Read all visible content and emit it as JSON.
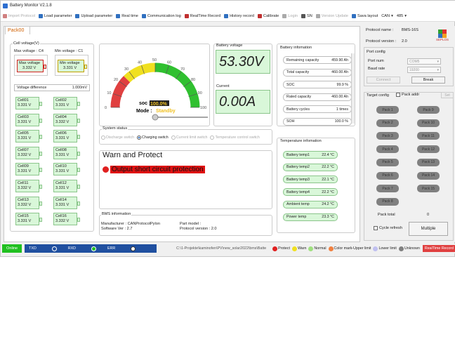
{
  "window": {
    "title": "Battery Monitor V2.1.8"
  },
  "toolbar": {
    "items": [
      {
        "label": "Import Protocol",
        "enabled": false,
        "color": "#d08080"
      },
      {
        "label": "Load parameter",
        "enabled": true,
        "color": "#3070c0"
      },
      {
        "label": "Upload parameter",
        "enabled": true,
        "color": "#3070c0"
      },
      {
        "label": "Real time",
        "enabled": true,
        "color": "#3070c0"
      },
      {
        "label": "Communication log",
        "enabled": true,
        "color": "#3070c0"
      },
      {
        "label": "RealTime Record",
        "enabled": true,
        "color": "#c03030"
      },
      {
        "label": "History record",
        "enabled": true,
        "color": "#3070c0"
      },
      {
        "label": "Calibrate",
        "enabled": true,
        "color": "#c03030"
      },
      {
        "label": "Login",
        "enabled": false,
        "color": "#aaaaaa"
      },
      {
        "label": "SN",
        "enabled": true,
        "color": "#555555"
      },
      {
        "label": "Version Update",
        "enabled": false,
        "color": "#aaaaaa"
      },
      {
        "label": "Sava layout",
        "enabled": true,
        "color": "#3070c0"
      }
    ],
    "protocol_select": "CAN",
    "model_select": "485"
  },
  "tab": "Pack00",
  "cell_voltage": {
    "title": "Cell voltage(V)",
    "max_label": "Max voltage : C4",
    "min_label": "Min voltage : C1",
    "max_box_label": "Max voltage",
    "max_box_value": "3.332 V",
    "min_box_label": "Min voltage",
    "min_box_value": "3.331 V",
    "diff_label": "Voltage difference",
    "diff_value": "1.000mV",
    "cells": [
      {
        "name": "Cell01",
        "v": "3.331 V"
      },
      {
        "name": "Cell02",
        "v": "3.331 V"
      },
      {
        "name": "Cell03",
        "v": "3.331 V"
      },
      {
        "name": "Cell04",
        "v": "3.332 V"
      },
      {
        "name": "Cell05",
        "v": "3.331 V"
      },
      {
        "name": "Cell06",
        "v": "3.331 V"
      },
      {
        "name": "Cell07",
        "v": "3.332 V"
      },
      {
        "name": "Cell08",
        "v": "3.331 V"
      },
      {
        "name": "Cell09",
        "v": "3.331 V"
      },
      {
        "name": "Cell10",
        "v": "3.331 V"
      },
      {
        "name": "Cell11",
        "v": "3.332 V"
      },
      {
        "name": "Cell12",
        "v": "3.331 V"
      },
      {
        "name": "Cell13",
        "v": "3.332 V"
      },
      {
        "name": "Cell14",
        "v": "3.331 V"
      },
      {
        "name": "Cell15",
        "v": "3.331 V"
      },
      {
        "name": "Cell16",
        "v": "3.332 V"
      }
    ]
  },
  "gauge": {
    "ticks": [
      "0",
      "10",
      "20",
      "30",
      "40",
      "50",
      "60",
      "70",
      "80",
      "90",
      "100"
    ],
    "soc_label": "soc :",
    "soc_value": "100.0%",
    "mode_label": "Mode :",
    "mode_value": "Standby",
    "level": 1.0
  },
  "battery_voltage": {
    "label": "Battery voltage",
    "value": "53.30V"
  },
  "current": {
    "label": "Current",
    "value": "0.00A"
  },
  "system_status": {
    "title": "System status",
    "items": [
      {
        "label": "Discharge switch",
        "on": false
      },
      {
        "label": "Charging switch",
        "on": true
      },
      {
        "label": "Current limit switch",
        "on": false
      },
      {
        "label": "Temperature control switch",
        "on": false
      }
    ]
  },
  "warn": {
    "title": "Warn and Protect",
    "message": "Output short circuit protection"
  },
  "bms_info": {
    "title": "BMS information",
    "manufacturer": "Manufacturer : CANProtocolPylon",
    "software": "Software Ver :  2.7",
    "part_model": "Part model :",
    "protocol_version": "Protocol version : 2.0"
  },
  "battery_info": {
    "title": "Battery infomation",
    "rows": [
      {
        "k": "Remaining capacity",
        "v": "459.90 Ah"
      },
      {
        "k": "Total capacity",
        "v": "460.00 Ah"
      },
      {
        "k": "SOC",
        "v": "99.9 %"
      },
      {
        "k": "Rated capacity",
        "v": "460.00 Ah"
      },
      {
        "k": "Battery cycles",
        "v": "1 times"
      },
      {
        "k": "SOH",
        "v": "100.0 %"
      }
    ]
  },
  "temperature": {
    "title": "Temperature infomation",
    "rows": [
      {
        "k": "Battery temp1",
        "v": "22.4 °C"
      },
      {
        "k": "Battery temp2",
        "v": "22.2 °C"
      },
      {
        "k": "Battery temp3",
        "v": "22.1 °C"
      },
      {
        "k": "Battery temp4",
        "v": "22.2 °C"
      },
      {
        "k": "Ambient temp",
        "v": "24.2 °C"
      },
      {
        "k": "Power temp",
        "v": "23.3 °C"
      }
    ]
  },
  "right": {
    "protocol_name_label": "Protocol name :",
    "protocol_name": "BMS-16S",
    "protocol_version_label": "Protocol version :",
    "protocol_version": "2.0",
    "logo": "SEPLOS",
    "port_config": "Port config",
    "port_num_label": "Port num",
    "port_num": "COM5",
    "baud_label": "Baud rate",
    "baud": "19200",
    "connect": "Connect",
    "break": "Break",
    "target_config": "Target config",
    "pack_addr": "Pack addr",
    "set": "Set",
    "packs": [
      "Pack 1",
      "Pack 9",
      "Pack 2",
      "Pack 10",
      "Pack 3",
      "Pack 11",
      "Pack 4",
      "Pack 12",
      "Pack 5",
      "Pack 13",
      "Pack 6",
      "Pack 14",
      "Pack 7",
      "Pack 15",
      "Pack 8"
    ],
    "pack_total_label": "Pack total",
    "pack_total": "0",
    "cycle_refresh": "Cycle refresh",
    "multiple": "Multiple"
  },
  "statusbar": {
    "online": "Online",
    "txd": "TXD",
    "rxd": "RXD",
    "err": "ERR",
    "path": "C:\\1-Projekte\\kaminofen\\PV\\new_solar2022\\bms\\Batte",
    "legend": [
      {
        "label": "Protect",
        "color": "#e02020"
      },
      {
        "label": "Warn",
        "color": "#f0e020"
      },
      {
        "label": "Normal",
        "color": "#a0e080"
      },
      {
        "label": "Color mark-Upper limit",
        "color": "#f08040"
      },
      {
        "label": "Lower limit",
        "color": "#c0c0f0"
      },
      {
        "label": "Unknown",
        "color": "#808080"
      }
    ],
    "realtime": "RealTime Record"
  }
}
